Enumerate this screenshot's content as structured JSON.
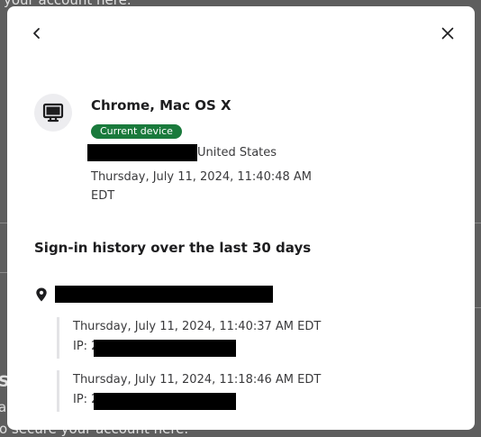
{
  "background": {
    "top_text": "your account here.",
    "side_letter": "S",
    "side_letter2": "a",
    "bottom_text": "o secure your account here."
  },
  "header": {
    "back_icon": "chevron-left-icon",
    "close_icon": "close-icon"
  },
  "device": {
    "icon": "monitor-icon",
    "name": "Chrome, Mac OS X",
    "badge": "Current device",
    "location_suffix": "United States",
    "timestamp": "Thursday, July 11, 2024, 11:40:48 AM EDT"
  },
  "history": {
    "title": "Sign-in history over the last 30 days",
    "pin_icon": "location-pin-icon",
    "entries": [
      {
        "time": "Thursday, July 11, 2024, 11:40:37 AM EDT",
        "ip_label": "IP: 2"
      },
      {
        "time": "Thursday, July 11, 2024, 11:18:46 AM EDT",
        "ip_label": "IP: 2"
      }
    ]
  },
  "colors": {
    "badge_bg": "#1a7a3c",
    "overlay": "#5e5e5e",
    "icon_circle": "#ededf0"
  }
}
